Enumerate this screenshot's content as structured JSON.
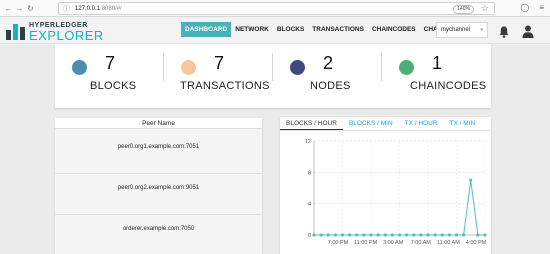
{
  "browser": {
    "url_host": "127.0.0.1",
    "url_path": ":8080/#/",
    "zoom": "140%"
  },
  "logo": {
    "top": "HYPERLEDGER",
    "bottom": "EXPLORER"
  },
  "nav": {
    "items": [
      "DASHBOARD",
      "NETWORK",
      "BLOCKS",
      "TRANSACTIONS",
      "CHAINCODES",
      "CHANNELS"
    ],
    "active": "DASHBOARD"
  },
  "channel_select": {
    "value": "mychannel"
  },
  "stats": [
    {
      "value": "7",
      "label": "BLOCKS",
      "icon": "cube-icon",
      "color": "#4a8eb0"
    },
    {
      "value": "7",
      "label": "TRANSACTIONS",
      "icon": "list-icon",
      "color": "#f7c79a"
    },
    {
      "value": "2",
      "label": "NODES",
      "icon": "users-icon",
      "color": "#3f4a7a"
    },
    {
      "value": "1",
      "label": "CHAINCODES",
      "icon": "handshake-icon",
      "color": "#4dae7a"
    }
  ],
  "peers": {
    "header": "Peer Name",
    "rows": [
      "peer0.org1.example.com:7051",
      "peer0.org2.example.com:9051",
      "orderer.example.com:7050"
    ]
  },
  "chart_tabs": [
    "BLOCKS / HOUR",
    "BLOCKS / MIN",
    "TX / HOUR",
    "TX / MIN"
  ],
  "active_chart_tab": "BLOCKS / HOUR",
  "colors": {
    "accent": "#4ab0b9",
    "line": "#52c1b8",
    "link": "#1e9fd6"
  },
  "chart_data": {
    "type": "line",
    "x_tick_labels": [
      "7:00 PM",
      "11:00 PM",
      "3:00 AM",
      "7:00 AM",
      "11:00 AM",
      "4:00 PM"
    ],
    "y_ticks": [
      0,
      4,
      8,
      12
    ],
    "ylim": [
      0,
      12
    ],
    "values": [
      0,
      0,
      0,
      0,
      0,
      0,
      0,
      0,
      0,
      0,
      0,
      0,
      0,
      0,
      0,
      0,
      0,
      0,
      0,
      0,
      0,
      0,
      7,
      0,
      0
    ],
    "grid": "dashed",
    "legend": "none"
  }
}
